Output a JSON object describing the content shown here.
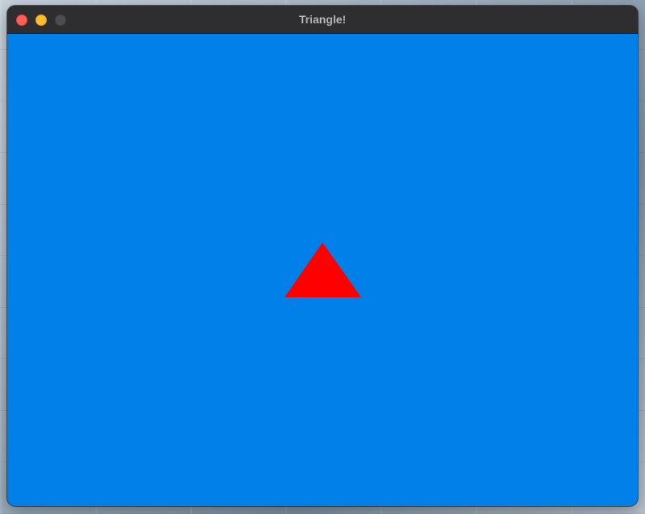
{
  "window": {
    "title": "Triangle!"
  },
  "colors": {
    "canvas_background": "#0080e8",
    "triangle_fill": "#ff0000",
    "titlebar": "#2e2e30",
    "close": "#ff5f57",
    "minimize": "#febc2e",
    "maximize_disabled": "#4d4d50"
  },
  "scene": {
    "shape": "triangle"
  }
}
